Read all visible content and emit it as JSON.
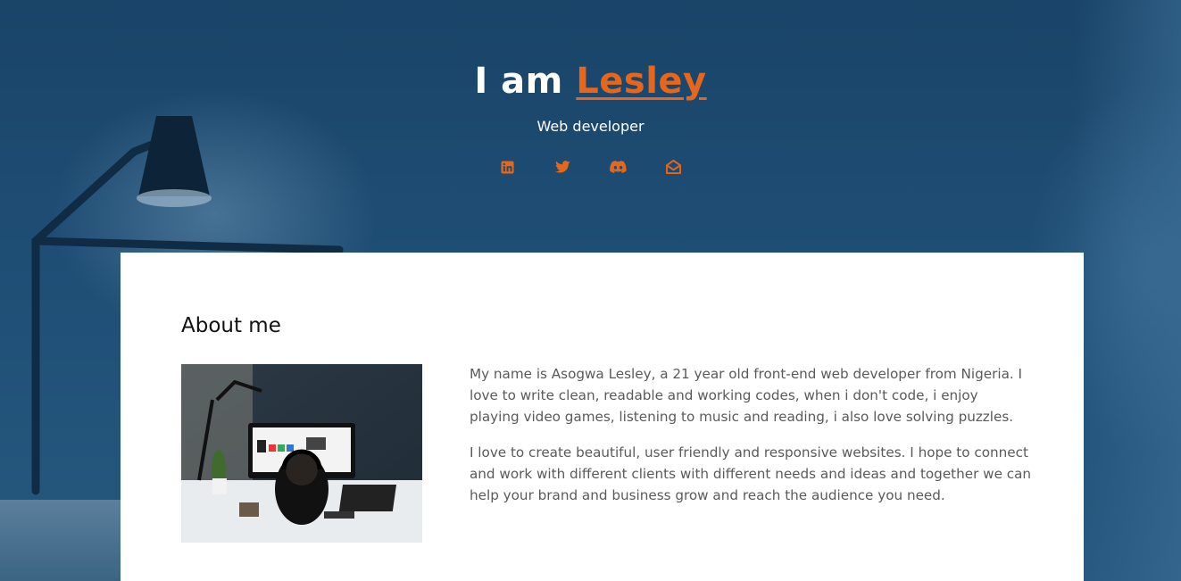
{
  "hero": {
    "title_prefix": "I am",
    "title_name": "Lesley",
    "subtitle": "Web developer",
    "accent_color": "#e8661a",
    "socials": [
      {
        "icon": "linkedin-icon"
      },
      {
        "icon": "twitter-icon"
      },
      {
        "icon": "discord-icon"
      },
      {
        "icon": "email-icon"
      }
    ]
  },
  "about": {
    "heading": "About me",
    "paragraphs": [
      "My name is Asogwa Lesley, a 21 year old front-end web developer from Nigeria. I love to write clean, readable and working codes, when i don't code, i enjoy playing video games, listening to music and reading, i also love solving puzzles.",
      "I love to create beautiful, user friendly and responsive websites. I hope to connect and work with different clients with different needs and ideas and together we can help your brand and business grow and reach the audience you need."
    ]
  }
}
